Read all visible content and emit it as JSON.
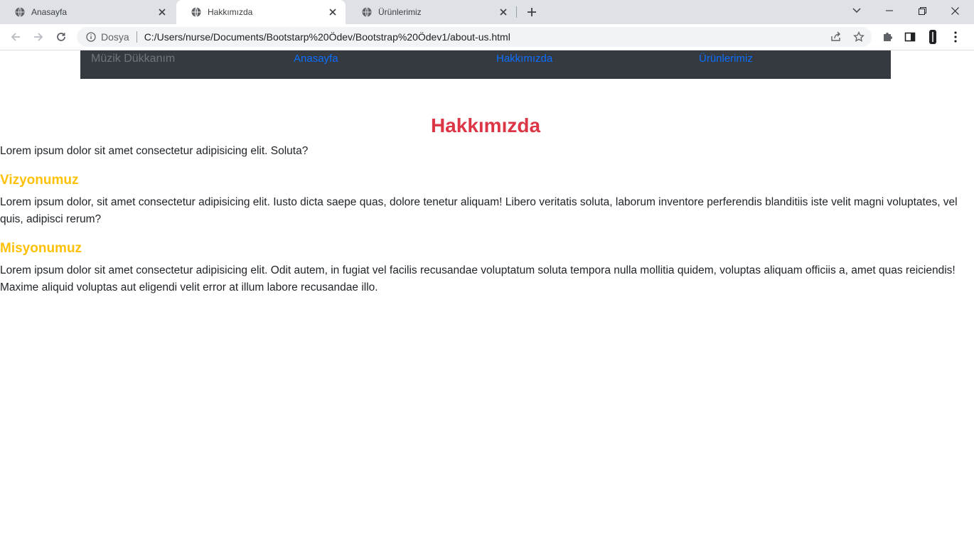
{
  "browser": {
    "tabs": [
      {
        "title": "Anasayfa",
        "active": false
      },
      {
        "title": "Hakkımızda",
        "active": true
      },
      {
        "title": "Ürünlerimiz",
        "active": false
      }
    ],
    "address": {
      "scheme_label": "Dosya",
      "url": "C:/Users/nurse/Documents/Bootstarp%20Ödev/Bootstrap%20Ödev1/about-us.html"
    }
  },
  "navbar": {
    "brand": "Müzik Dükkanım",
    "links": [
      "Anasayfa",
      "Hakkımızda",
      "Ürünlerimiz"
    ]
  },
  "content": {
    "title": "Hakkımızda",
    "intro": "Lorem ipsum dolor sit amet consectetur adipisicing elit. Soluta?",
    "vision": {
      "heading": "Vizyonumuz",
      "text": "Lorem ipsum dolor, sit amet consectetur adipisicing elit. Iusto dicta saepe quas, dolore tenetur aliquam! Libero veritatis soluta, laborum inventore perferendis blanditiis iste velit magni voluptates, vel quis, adipisci rerum?"
    },
    "mission": {
      "heading": "Misyonumuz",
      "text": "Lorem ipsum dolor sit amet consectetur adipisicing elit. Odit autem, in fugiat vel facilis recusandae voluptatum soluta tempora nulla mollitia quidem, voluptas aliquam officiis a, amet quas reiciendis! Maxime aliquid voluptas aut eligendi velit error at illum labore recusandae illo."
    }
  },
  "colors": {
    "navbar_bg": "#343a40",
    "link": "#0d6efd",
    "title": "#dc3545",
    "section_heading": "#ffc107"
  }
}
